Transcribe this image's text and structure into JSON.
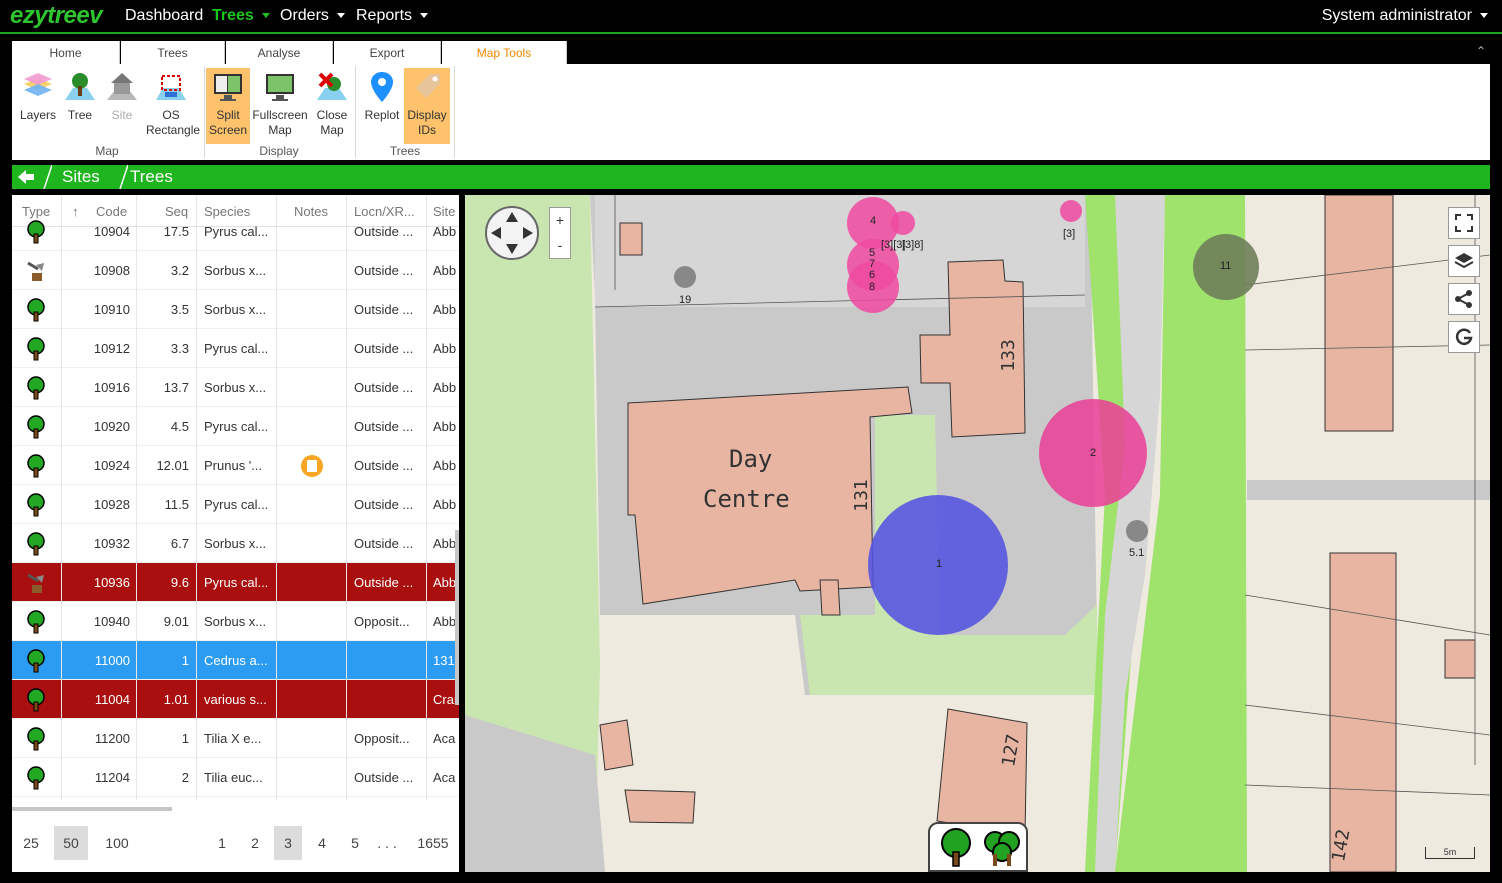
{
  "app": {
    "logo": "ezytreev",
    "brand_color": "#1fb51f"
  },
  "nav": {
    "items": [
      {
        "label": "Dashboard",
        "active": false,
        "dropdown": false
      },
      {
        "label": "Trees",
        "active": true,
        "dropdown": true
      },
      {
        "label": "Orders",
        "active": false,
        "dropdown": true
      },
      {
        "label": "Reports",
        "active": false,
        "dropdown": true
      }
    ],
    "user": "System administrator"
  },
  "ribbon": {
    "tabs": [
      "Home",
      "Trees",
      "Analyse",
      "Export",
      "Map Tools"
    ],
    "active_tab": "Map Tools",
    "groups": [
      {
        "label": "Map",
        "buttons": [
          {
            "label": "Layers",
            "icon": "layers-icon",
            "enabled": true,
            "selected": false
          },
          {
            "label": "Tree",
            "icon": "tree-add-icon",
            "enabled": true,
            "selected": false
          },
          {
            "label": "Site",
            "icon": "site-house-icon",
            "enabled": false,
            "selected": false
          },
          {
            "label": "OS Rectangle",
            "icon": "os-rectangle-icon",
            "enabled": true,
            "selected": false
          }
        ]
      },
      {
        "label": "Display",
        "buttons": [
          {
            "label": "Split Screen",
            "icon": "split-screen-icon",
            "enabled": true,
            "selected": true
          },
          {
            "label": "Fullscreen Map",
            "icon": "fullscreen-map-icon",
            "enabled": true,
            "selected": false
          },
          {
            "label": "Close Map",
            "icon": "close-map-icon",
            "enabled": true,
            "selected": false
          }
        ]
      },
      {
        "label": "Trees",
        "buttons": [
          {
            "label": "Replot",
            "icon": "map-pin-icon",
            "enabled": true,
            "selected": false
          },
          {
            "label": "Display IDs",
            "icon": "tag-icon",
            "enabled": true,
            "selected": true
          }
        ]
      }
    ]
  },
  "breadcrumb": {
    "items": [
      "Sites",
      "Trees"
    ]
  },
  "grid": {
    "columns": [
      "Type",
      "Code",
      "Seq",
      "Species",
      "Notes",
      "Locn/XR...",
      "Site"
    ],
    "sort_column": "Code",
    "rows": [
      {
        "type": "tree",
        "code": "10904",
        "seq": "17.5",
        "species": "Pyrus cal...",
        "note": false,
        "locn": "Outside ...",
        "site": "Abb",
        "state": "normal"
      },
      {
        "type": "felled",
        "code": "10908",
        "seq": "3.2",
        "species": "Sorbus x...",
        "note": false,
        "locn": "Outside ...",
        "site": "Abb",
        "state": "normal"
      },
      {
        "type": "tree",
        "code": "10910",
        "seq": "3.5",
        "species": "Sorbus x...",
        "note": false,
        "locn": "Outside ...",
        "site": "Abb",
        "state": "normal"
      },
      {
        "type": "tree",
        "code": "10912",
        "seq": "3.3",
        "species": "Pyrus cal...",
        "note": false,
        "locn": "Outside ...",
        "site": "Abb",
        "state": "normal"
      },
      {
        "type": "tree",
        "code": "10916",
        "seq": "13.7",
        "species": "Sorbus x...",
        "note": false,
        "locn": "Outside ...",
        "site": "Abb",
        "state": "normal"
      },
      {
        "type": "tree",
        "code": "10920",
        "seq": "4.5",
        "species": "Pyrus cal...",
        "note": false,
        "locn": "Outside ...",
        "site": "Abb",
        "state": "normal"
      },
      {
        "type": "tree",
        "code": "10924",
        "seq": "12.01",
        "species": "Prunus '...",
        "note": true,
        "locn": "Outside ...",
        "site": "Abb",
        "state": "normal"
      },
      {
        "type": "tree",
        "code": "10928",
        "seq": "11.5",
        "species": "Pyrus cal...",
        "note": false,
        "locn": "Outside ...",
        "site": "Abb",
        "state": "normal"
      },
      {
        "type": "tree",
        "code": "10932",
        "seq": "6.7",
        "species": "Sorbus x...",
        "note": false,
        "locn": "Outside ...",
        "site": "Abb",
        "state": "normal"
      },
      {
        "type": "felled",
        "code": "10936",
        "seq": "9.6",
        "species": "Pyrus cal...",
        "note": false,
        "locn": "Outside ...",
        "site": "Abb",
        "state": "red"
      },
      {
        "type": "tree",
        "code": "10940",
        "seq": "9.01",
        "species": "Sorbus x...",
        "note": false,
        "locn": "Opposit...",
        "site": "Abb",
        "state": "normal"
      },
      {
        "type": "tree",
        "code": "11000",
        "seq": "1",
        "species": "Cedrus a...",
        "note": false,
        "locn": "",
        "site": "131",
        "state": "blue"
      },
      {
        "type": "tree",
        "code": "11004",
        "seq": "1.01",
        "species": "various s...",
        "note": false,
        "locn": "",
        "site": "Cran",
        "state": "red"
      },
      {
        "type": "tree",
        "code": "11200",
        "seq": "1",
        "species": "Tilia X e...",
        "note": false,
        "locn": "Opposit...",
        "site": "Aca",
        "state": "normal"
      },
      {
        "type": "tree",
        "code": "11204",
        "seq": "2",
        "species": "Tilia euc...",
        "note": false,
        "locn": "Outside ...",
        "site": "Aca",
        "state": "normal"
      }
    ]
  },
  "pager": {
    "page_sizes": [
      "25",
      "50",
      "100"
    ],
    "selected_size": "50",
    "pages": [
      "1",
      "2",
      "3",
      "4",
      "5"
    ],
    "current_page": "3",
    "ellipsis": ". . .",
    "last_page": "1655"
  },
  "map": {
    "zoom_in": "+",
    "zoom_out": "-",
    "building_labels": [
      "Day",
      "Centre",
      "131",
      "133",
      "127",
      "142"
    ],
    "tree_labels": [
      "1",
      "2",
      "4",
      "[3]",
      "[3][3]",
      "[3]8]",
      "5",
      "7",
      "6",
      "8",
      "11",
      "19",
      "5.1"
    ],
    "scale_label": "5m",
    "tools": [
      "fullscreen-icon",
      "layers-stack-icon",
      "share-icon",
      "google-icon"
    ]
  }
}
